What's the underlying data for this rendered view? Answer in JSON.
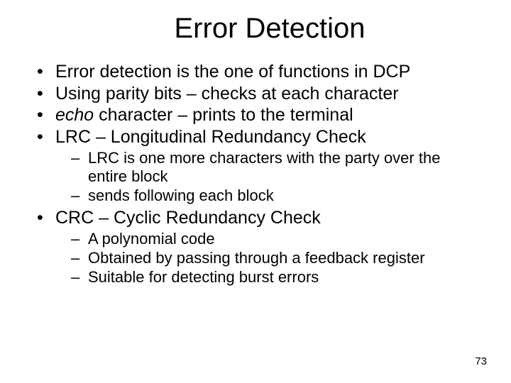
{
  "title": "Error Detection",
  "bullets": {
    "b0": "Error detection is the one of functions in DCP",
    "b1": "Using parity bits – checks at each character",
    "b2_pre": "echo",
    "b2_post": " character – prints to the terminal",
    "b3": "LRC – Longitudinal Redundancy Check",
    "b3_sub0": "LRC is one more characters with the party over the entire block",
    "b3_sub1": "sends following each block",
    "b4": "CRC – Cyclic Redundancy Check",
    "b4_sub0": "A polynomial code",
    "b4_sub1": "Obtained by passing through a feedback register",
    "b4_sub2": "Suitable for detecting burst errors"
  },
  "page_number": "73"
}
